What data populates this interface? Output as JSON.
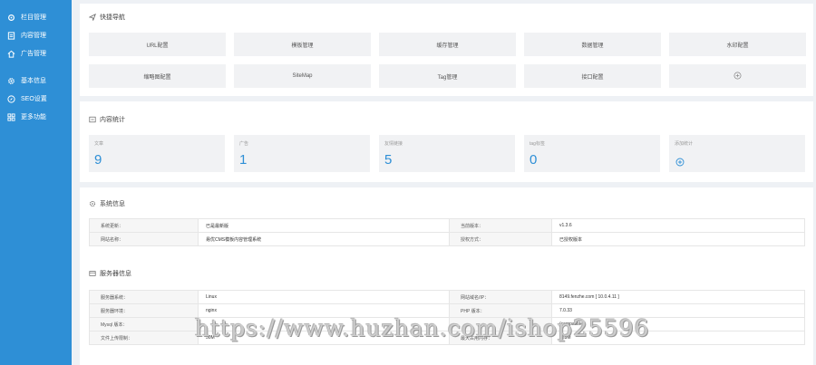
{
  "sidebar": {
    "items": [
      {
        "label": "栏目管理",
        "icon": "settings-icon"
      },
      {
        "label": "内容管理",
        "icon": "document-icon"
      },
      {
        "label": "广告管理",
        "icon": "home-icon"
      },
      {
        "label": "基本信息",
        "icon": "gear-icon"
      },
      {
        "label": "SEO设置",
        "icon": "compass-icon"
      },
      {
        "label": "更多功能",
        "icon": "grid-icon"
      }
    ]
  },
  "quicknav": {
    "title": "快捷导航",
    "items": [
      "URL配置",
      "模板管理",
      "缓存管理",
      "数据管理",
      "水印配置",
      "缩略图配置",
      "SiteMap",
      "Tag管理",
      "接口配置"
    ]
  },
  "stats": {
    "title": "内容统计",
    "items": [
      {
        "label": "文章",
        "value": "9"
      },
      {
        "label": "广告",
        "value": "1"
      },
      {
        "label": "友情链接",
        "value": "5"
      },
      {
        "label": "tag标签",
        "value": "0"
      },
      {
        "label": "添加统计",
        "value": ""
      }
    ]
  },
  "sysinfo": {
    "title": "系统信息",
    "rows": [
      [
        "系统更新：",
        "已是最新版",
        "当前版本：",
        "v1.3.6"
      ],
      [
        "网站名称：",
        "易优CMS模板内容管理系统",
        "授权方式：",
        "已授权版本"
      ]
    ]
  },
  "server": {
    "title": "服务器信息",
    "rows": [
      [
        "服务器系统：",
        "Linux",
        "网站域名/IP：",
        "8149.fenzhe.com [ 10.0.4.11 ]"
      ],
      [
        "服务器环境：",
        "nginx",
        "PHP 版本：",
        "7.0.33"
      ],
      [
        "Mysql 版本：",
        "",
        "",
        "(compatible)"
      ],
      [
        "文件上传限制：",
        "50M",
        "最大占用内存：",
        "128M"
      ]
    ]
  },
  "watermark": "https://www.huzhan.com/ishop25596",
  "colors": {
    "accent": "#2e8fd6",
    "sidebar": "#2e8fd6",
    "background": "#eef1f5"
  }
}
